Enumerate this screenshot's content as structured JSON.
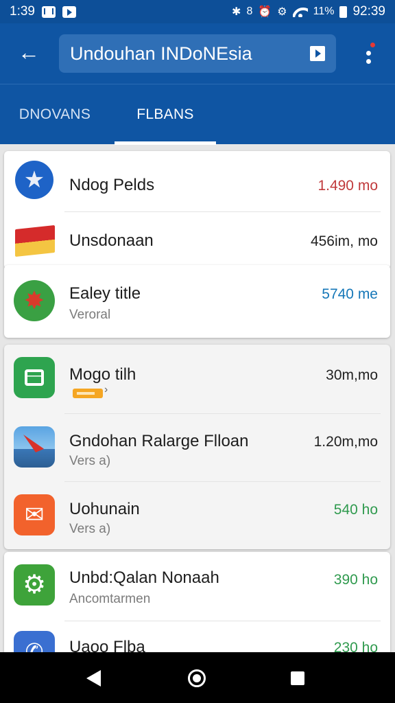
{
  "status": {
    "time": "1:39",
    "right_clock": "92:39",
    "battery": "11%"
  },
  "appbar": {
    "search_text": "Undouhan INDoNEsia"
  },
  "tabs": [
    {
      "label": "DNOVANS",
      "selected": false
    },
    {
      "label": "FLBANS",
      "selected": true
    }
  ],
  "items": [
    {
      "icon": "star-icon",
      "title": "Ndog Pelds",
      "subtitle": "",
      "size": "1.490 mo",
      "size_color": "#c0393b"
    },
    {
      "icon": "flag-icon",
      "title": "Unsdonaan",
      "subtitle": "",
      "size": "456im, mo",
      "size_color": "#222222"
    },
    {
      "icon": "green-burst-icon",
      "title": "Ealey title",
      "subtitle": "Veroral",
      "size": "5740 me",
      "size_color": "#1577b8"
    },
    {
      "icon": "document-icon",
      "title": "Mogo tilh",
      "subtitle": "",
      "size": "30m,mo",
      "size_color": "#222222",
      "badge": true
    },
    {
      "icon": "photo-icon",
      "title": "Gndohan Ralarge Flloan",
      "subtitle": "Vers a)",
      "size": "1.20m,mo",
      "size_color": "#222222"
    },
    {
      "icon": "mail-icon",
      "title": "Uohunain",
      "subtitle": "Vers a)",
      "size": "540 ho",
      "size_color": "#2f9a4e"
    },
    {
      "icon": "gear-icon",
      "title": "Unbd:Qalan Nonaah",
      "subtitle": "Ancomtarmen",
      "size": "390 ho",
      "size_color": "#2f9a4e"
    },
    {
      "icon": "phone-icon",
      "title": "Uaoo Flba",
      "subtitle": "",
      "size": "230 ho",
      "size_color": "#2f9a4e"
    }
  ]
}
